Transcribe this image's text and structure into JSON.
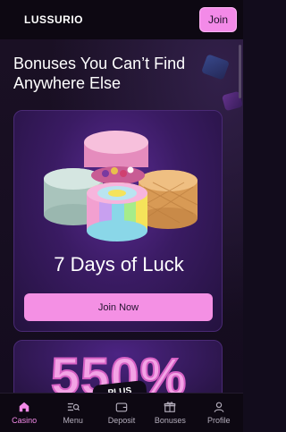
{
  "header": {
    "logo": "LUSSURIO",
    "join_label": "Join"
  },
  "main": {
    "title": "Bonuses You Can’t Find Anywhere Else",
    "promos": [
      {
        "title": "7 Days of Luck",
        "button_label": "Join Now"
      },
      {
        "big_text": "550%",
        "badge": "PLUS"
      }
    ]
  },
  "nav": {
    "items": [
      {
        "label": "Casino",
        "icon": "home-icon",
        "active": true
      },
      {
        "label": "Menu",
        "icon": "menu-search-icon",
        "active": false
      },
      {
        "label": "Deposit",
        "icon": "wallet-icon",
        "active": false
      },
      {
        "label": "Bonuses",
        "icon": "gift-icon",
        "active": false
      },
      {
        "label": "Profile",
        "icon": "user-icon",
        "active": false
      }
    ]
  },
  "colors": {
    "accent": "#f38ae8",
    "background": "#120c1c",
    "card": "#3a1b63"
  }
}
